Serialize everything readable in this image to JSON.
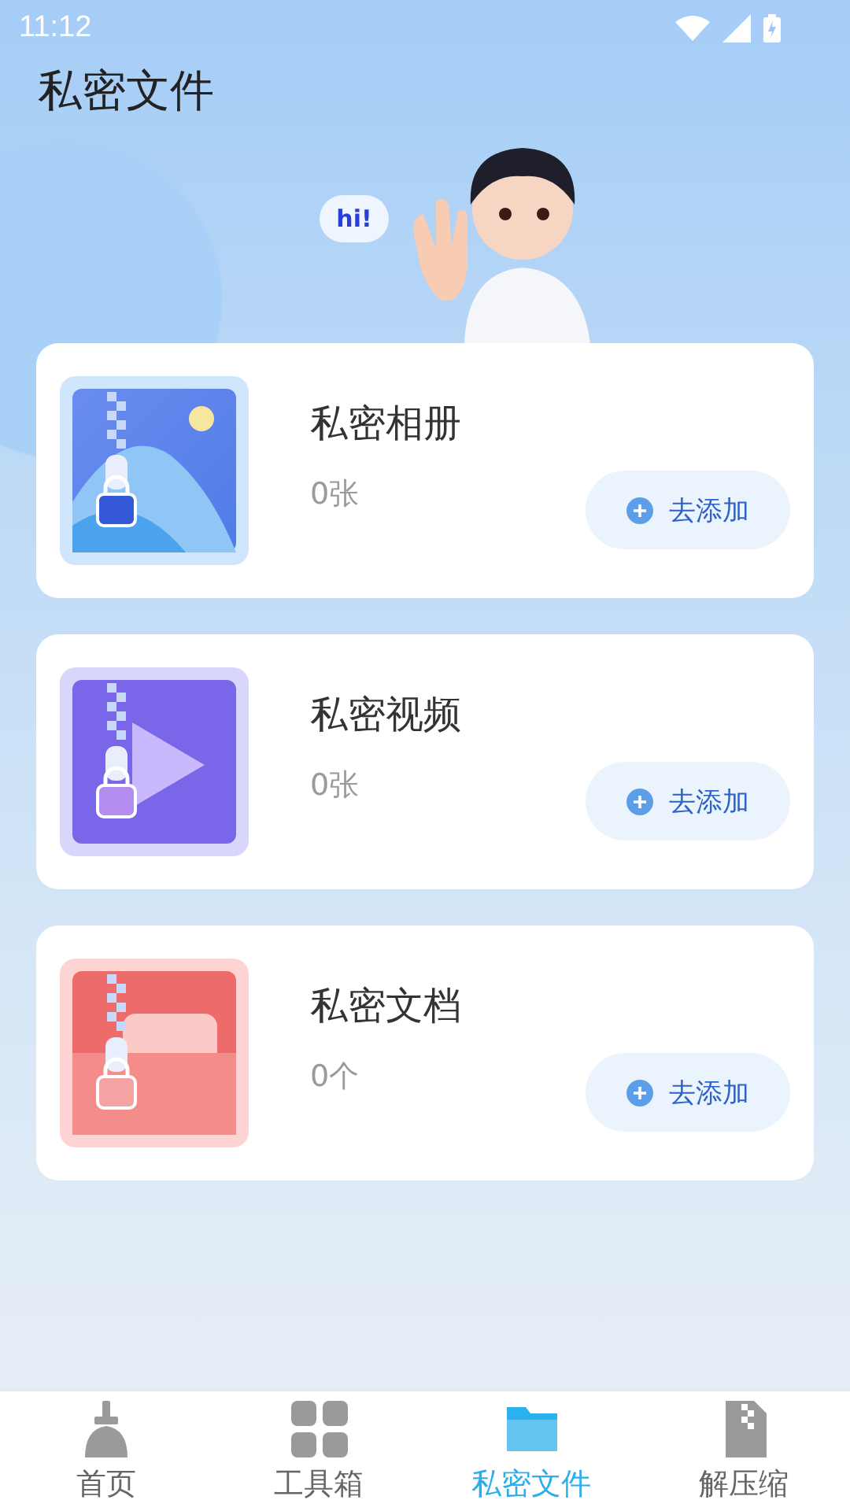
{
  "status_bar": {
    "time": "11:12"
  },
  "title": "私密文件",
  "greeting": "hi!",
  "sections": [
    {
      "kind": "photo",
      "title": "私密相册",
      "count": "0张",
      "button": "去添加"
    },
    {
      "kind": "video",
      "title": "私密视频",
      "count": "0张",
      "button": "去添加"
    },
    {
      "kind": "document",
      "title": "私密文档",
      "count": "0个",
      "button": "去添加"
    }
  ],
  "tabs": [
    {
      "kind": "home",
      "label": "首页",
      "selected": false
    },
    {
      "kind": "tools",
      "label": "工具箱",
      "selected": false
    },
    {
      "kind": "files",
      "label": "私密文件",
      "selected": true
    },
    {
      "kind": "unzip",
      "label": "解压缩",
      "selected": false
    }
  ]
}
